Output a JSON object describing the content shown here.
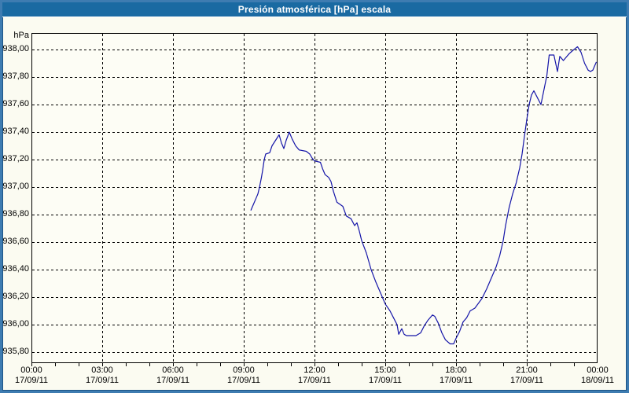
{
  "window": {
    "title": "Presión atmosférica [hPa] escala"
  },
  "colors": {
    "frame": "#3E7CB1",
    "titlebar": "#1A6AA2",
    "background": "#FBFBF1",
    "plot_background": "#FDFDF5",
    "grid": "#000000",
    "line": "#1515A8",
    "text": "#000000",
    "title_text": "#FFFFFF"
  },
  "axes": {
    "unit_label": "hPa",
    "y_ticks": [
      "938,00",
      "937,80",
      "937,60",
      "937,40",
      "937,20",
      "937,00",
      "936,80",
      "936,60",
      "936,40",
      "936,20",
      "936,00",
      "935,80"
    ],
    "x_ticks": [
      {
        "time": "00:00",
        "date": "17/09/11"
      },
      {
        "time": "03:00",
        "date": "17/09/11"
      },
      {
        "time": "06:00",
        "date": "17/09/11"
      },
      {
        "time": "09:00",
        "date": "17/09/11"
      },
      {
        "time": "12:00",
        "date": "17/09/11"
      },
      {
        "time": "15:00",
        "date": "17/09/11"
      },
      {
        "time": "18:00",
        "date": "17/09/11"
      },
      {
        "time": "21:00",
        "date": "17/09/11"
      },
      {
        "time": "00:00",
        "date": "18/09/11"
      }
    ]
  },
  "chart_data": {
    "type": "line",
    "title": "Presión atmosférica [hPa] escala",
    "ylabel": "hPa",
    "xlabel": "time, 17/09/11 00:00 to 18/09/11 00:00",
    "xlim_hours": [
      0,
      24
    ],
    "ylim": [
      935.72,
      938.12
    ],
    "y_gridlines": [
      938.0,
      937.8,
      937.6,
      937.4,
      937.2,
      937.0,
      936.8,
      936.6,
      936.4,
      936.2,
      936.0,
      935.8
    ],
    "x_gridline_hours": [
      0,
      3,
      6,
      9,
      12,
      15,
      18,
      21,
      24
    ],
    "grid": "dashed",
    "legend": "none",
    "series": [
      {
        "name": "Presión atmosférica",
        "color": "#1515A8",
        "points_hour_hpa": [
          [
            9.3,
            936.83
          ],
          [
            9.4,
            936.87
          ],
          [
            9.5,
            936.91
          ],
          [
            9.6,
            936.95
          ],
          [
            9.67,
            937.0
          ],
          [
            9.75,
            937.07
          ],
          [
            9.8,
            937.12
          ],
          [
            9.87,
            937.2
          ],
          [
            9.93,
            937.24
          ],
          [
            10.1,
            937.25
          ],
          [
            10.2,
            937.3
          ],
          [
            10.35,
            937.34
          ],
          [
            10.5,
            937.38
          ],
          [
            10.6,
            937.32
          ],
          [
            10.7,
            937.28
          ],
          [
            10.8,
            937.34
          ],
          [
            10.93,
            937.4
          ],
          [
            11.05,
            937.35
          ],
          [
            11.2,
            937.3
          ],
          [
            11.35,
            937.27
          ],
          [
            11.65,
            937.26
          ],
          [
            11.8,
            937.24
          ],
          [
            11.9,
            937.21
          ],
          [
            12.0,
            937.19
          ],
          [
            12.25,
            937.18
          ],
          [
            12.35,
            937.13
          ],
          [
            12.45,
            937.09
          ],
          [
            12.6,
            937.07
          ],
          [
            12.7,
            937.04
          ],
          [
            12.8,
            936.97
          ],
          [
            12.95,
            936.89
          ],
          [
            13.2,
            936.86
          ],
          [
            13.35,
            936.79
          ],
          [
            13.55,
            936.77
          ],
          [
            13.7,
            936.72
          ],
          [
            13.8,
            936.74
          ],
          [
            13.9,
            936.68
          ],
          [
            14.0,
            936.61
          ],
          [
            14.2,
            936.52
          ],
          [
            14.4,
            936.4
          ],
          [
            14.6,
            936.31
          ],
          [
            14.8,
            936.23
          ],
          [
            15.0,
            936.15
          ],
          [
            15.2,
            936.1
          ],
          [
            15.35,
            936.05
          ],
          [
            15.5,
            936.0
          ],
          [
            15.57,
            935.93
          ],
          [
            15.7,
            935.97
          ],
          [
            15.8,
            935.93
          ],
          [
            15.9,
            935.92
          ],
          [
            16.3,
            935.92
          ],
          [
            16.5,
            935.94
          ],
          [
            16.65,
            935.99
          ],
          [
            16.8,
            936.03
          ],
          [
            17.0,
            936.07
          ],
          [
            17.1,
            936.06
          ],
          [
            17.25,
            936.01
          ],
          [
            17.4,
            935.94
          ],
          [
            17.55,
            935.89
          ],
          [
            17.75,
            935.86
          ],
          [
            17.9,
            935.86
          ],
          [
            18.0,
            935.9
          ],
          [
            18.15,
            935.95
          ],
          [
            18.3,
            936.02
          ],
          [
            18.45,
            936.05
          ],
          [
            18.6,
            936.1
          ],
          [
            18.8,
            936.12
          ],
          [
            19.1,
            936.19
          ],
          [
            19.3,
            936.26
          ],
          [
            19.5,
            936.34
          ],
          [
            19.7,
            936.42
          ],
          [
            19.85,
            936.5
          ],
          [
            20.0,
            936.61
          ],
          [
            20.1,
            936.72
          ],
          [
            20.25,
            936.85
          ],
          [
            20.4,
            936.95
          ],
          [
            20.55,
            937.03
          ],
          [
            20.7,
            937.14
          ],
          [
            20.8,
            937.24
          ],
          [
            20.9,
            937.37
          ],
          [
            21.0,
            937.49
          ],
          [
            21.1,
            937.6
          ],
          [
            21.2,
            937.67
          ],
          [
            21.3,
            937.7
          ],
          [
            21.45,
            937.65
          ],
          [
            21.6,
            937.6
          ],
          [
            21.85,
            937.81
          ],
          [
            21.95,
            937.96
          ],
          [
            22.15,
            937.96
          ],
          [
            22.3,
            937.84
          ],
          [
            22.4,
            937.95
          ],
          [
            22.55,
            937.92
          ],
          [
            22.65,
            937.94
          ],
          [
            22.8,
            937.97
          ],
          [
            23.0,
            938.0
          ],
          [
            23.15,
            938.02
          ],
          [
            23.3,
            937.98
          ],
          [
            23.45,
            937.9
          ],
          [
            23.6,
            937.85
          ],
          [
            23.7,
            937.84
          ],
          [
            23.8,
            937.85
          ],
          [
            23.9,
            937.89
          ],
          [
            23.95,
            937.91
          ]
        ]
      }
    ]
  }
}
